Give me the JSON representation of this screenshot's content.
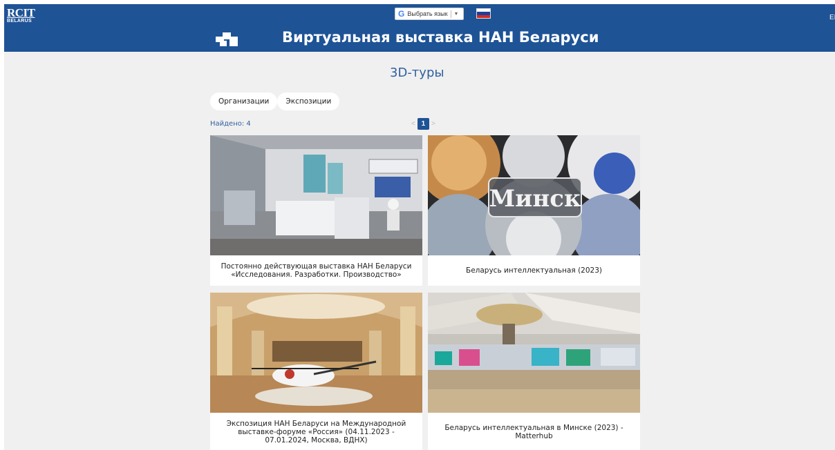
{
  "header": {
    "rcit_logo_big": "RCIT",
    "rcit_logo_small": "BELARUS",
    "lang_select_label": "Выбрать язык",
    "lang_select_arrow": "▼",
    "lang_google_icon": "google-g-icon",
    "flag": "russian-flag",
    "alt_lang": "EI",
    "site_title": "Виртуальная выставка НАН Беларуси",
    "brand_color": "#1e5396"
  },
  "main": {
    "heading": "3D-туры",
    "tabs": [
      {
        "label": "Организации"
      },
      {
        "label": "Экспозиции"
      }
    ],
    "found_text": "Найдено: 4",
    "pagination": {
      "prev": "<",
      "current": "1",
      "next": ">"
    },
    "cards": [
      {
        "caption": "Постоянно действующая выставка НАН Беларуси «Исследования. Разработки. Производство»",
        "image": "exhibition-hall-photo"
      },
      {
        "caption": "Беларусь интеллектуальная (2023)",
        "image": "minsk-panorama-collage",
        "image_text": "Минск"
      },
      {
        "caption": "Экспозиция НАН Беларуси на Международной выставке-форуме «Россия» (04.11.2023 - 07.01.2024, Москва, ВДНХ)",
        "image": "helicopter-pavilion-photo"
      },
      {
        "caption": "Беларусь интеллектуальная в Минске (2023) - Matterhub",
        "image": "large-expo-hall-photo"
      }
    ]
  }
}
